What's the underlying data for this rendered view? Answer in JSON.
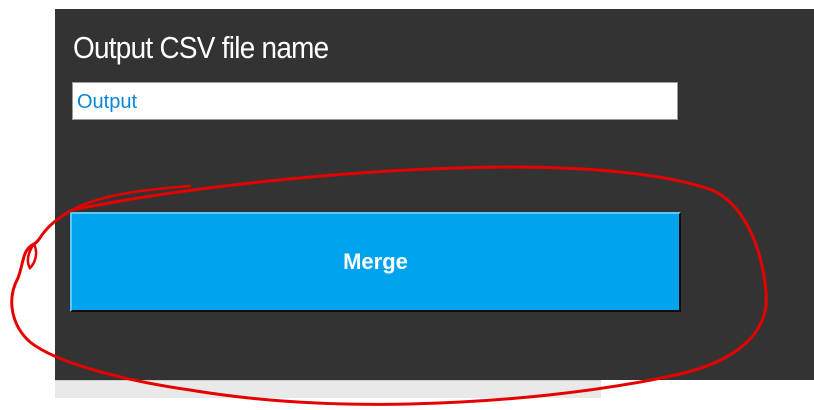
{
  "form": {
    "output_label": "Output CSV file name",
    "output_value": "Output",
    "merge_label": "Merge"
  },
  "colors": {
    "panel_background": "#333333",
    "button_accent": "#00a3ee",
    "input_text": "#0a86d8",
    "annotation_stroke": "#e60000"
  }
}
